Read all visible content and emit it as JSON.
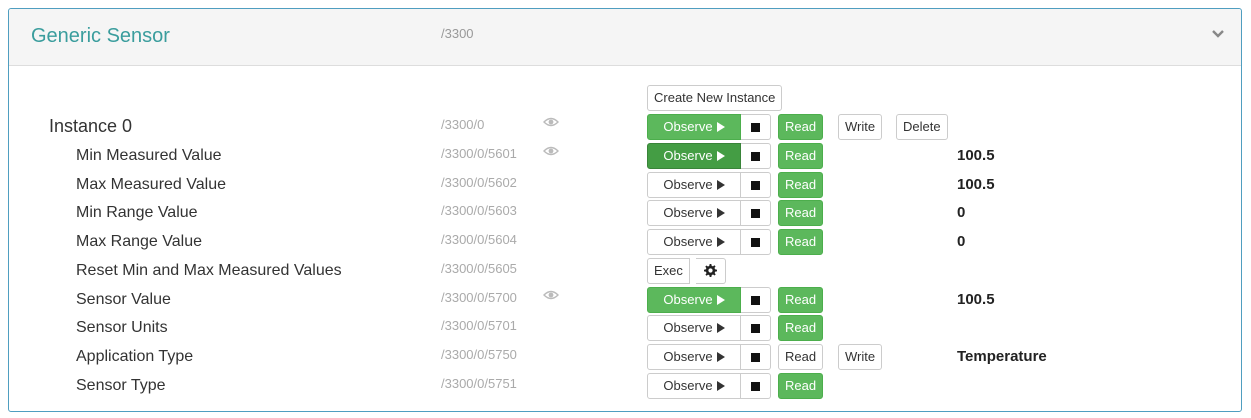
{
  "panel": {
    "title": "Generic Sensor",
    "path": "/3300",
    "toggle_icon": "chevron-down-icon"
  },
  "create_instance_label": "Create New Instance",
  "labels": {
    "observe": "Observe",
    "read": "Read",
    "write": "Write",
    "delete": "Delete",
    "exec": "Exec"
  },
  "instance": {
    "name": "Instance 0",
    "path": "/3300/0",
    "observed": true
  },
  "resources": [
    {
      "name": "Min Measured Value",
      "path": "/3300/0/5601",
      "value": "100.5",
      "observed": true
    },
    {
      "name": "Max Measured Value",
      "path": "/3300/0/5602",
      "value": "100.5",
      "observed": false
    },
    {
      "name": "Min Range Value",
      "path": "/3300/0/5603",
      "value": "0",
      "observed": false
    },
    {
      "name": "Max Range Value",
      "path": "/3300/0/5604",
      "value": "0",
      "observed": false
    },
    {
      "name": "Reset Min and Max Measured Values",
      "path": "/3300/0/5605",
      "value": "",
      "observed": false
    },
    {
      "name": "Sensor Value",
      "path": "/3300/0/5700",
      "value": "100.5",
      "observed": true
    },
    {
      "name": "Sensor Units",
      "path": "/3300/0/5701",
      "value": "",
      "observed": false
    },
    {
      "name": "Application Type",
      "path": "/3300/0/5750",
      "value": "Temperature",
      "observed": false
    },
    {
      "name": "Sensor Type",
      "path": "/3300/0/5751",
      "value": "",
      "observed": false
    }
  ]
}
